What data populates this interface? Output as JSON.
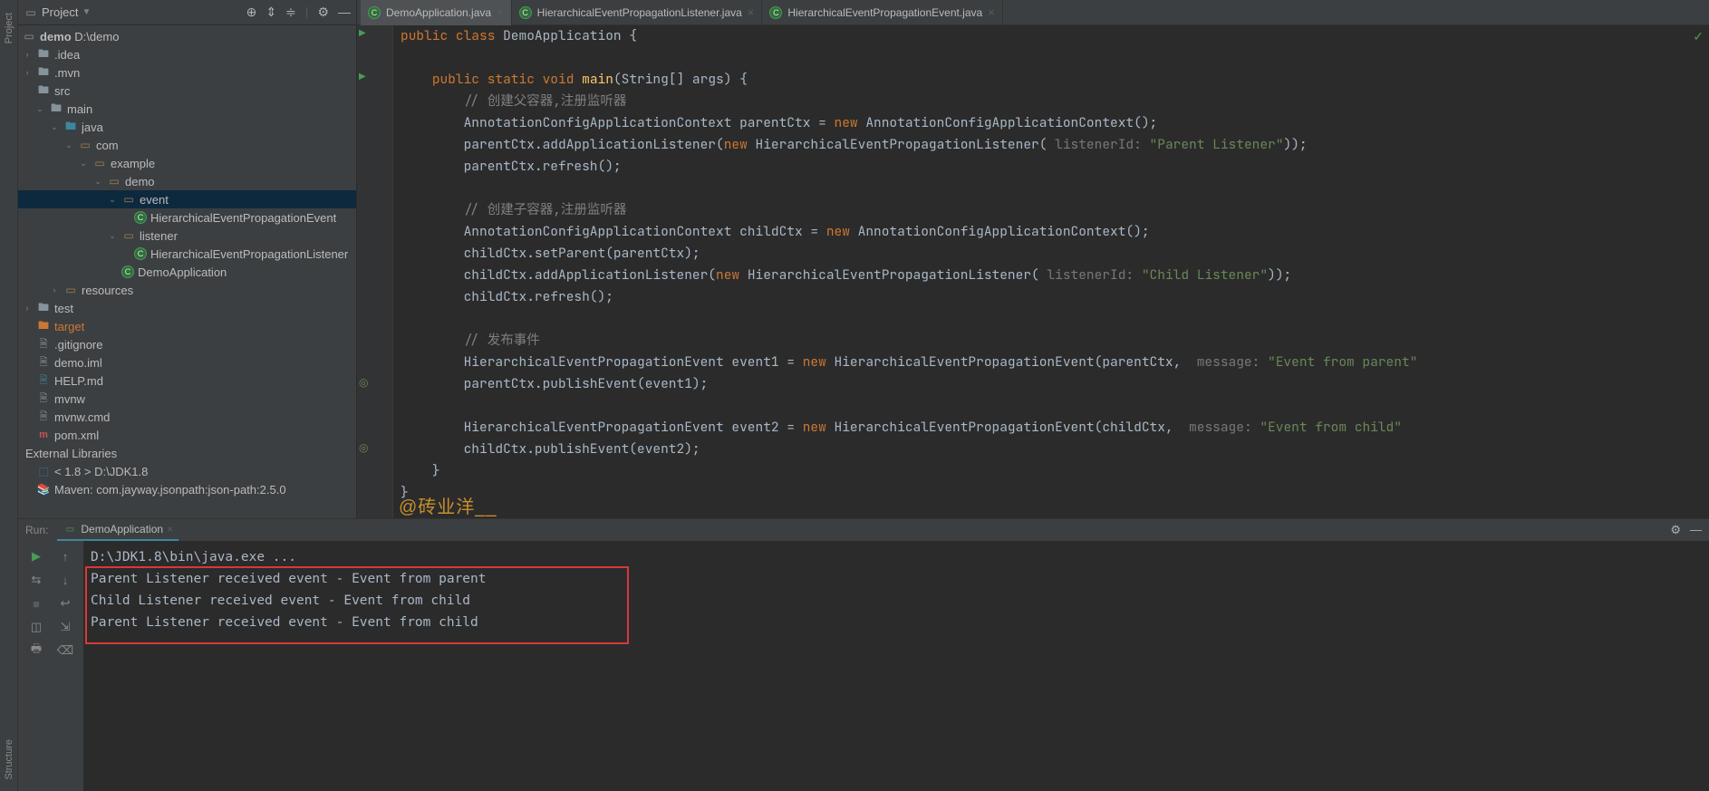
{
  "sidebar": {
    "title": "Project",
    "root_name": "demo",
    "root_path": "D:\\demo",
    "nodes": {
      "idea": ".idea",
      "mvn": ".mvn",
      "src": "src",
      "main": "main",
      "java": "java",
      "com": "com",
      "example": "example",
      "demo": "demo",
      "event": "event",
      "hev": "HierarchicalEventPropagationEvent",
      "listener": "listener",
      "hlis": "HierarchicalEventPropagationListener",
      "demoapp": "DemoApplication",
      "resources": "resources",
      "test": "test",
      "target": "target",
      "gitignore": ".gitignore",
      "demoiml": "demo.iml",
      "help": "HELP.md",
      "mvnw": "mvnw",
      "mvnwcmd": "mvnw.cmd",
      "pom": "pom.xml",
      "extlib": "External Libraries",
      "jdk_left": "< 1.8 >",
      "jdk_path": "D:\\JDK1.8",
      "maven": "Maven: com.jayway.jsonpath:json-path:2.5.0"
    }
  },
  "tabs": {
    "t1": "DemoApplication.java",
    "t2": "HierarchicalEventPropagationListener.java",
    "t3": "HierarchicalEventPropagationEvent.java"
  },
  "code": {
    "l1a": "public class ",
    "l1b": "DemoApplication",
    "l1c": " {",
    "l3a": "public static void ",
    "l3b": "main",
    "l3c": "(String[] args) {",
    "l4": "// 创建父容器,注册监听器",
    "l5a": "AnnotationConfigApplicationContext parentCtx = ",
    "l5b": "new ",
    "l5c": "AnnotationConfigApplicationContext();",
    "l6a": "parentCtx.addApplicationListener(",
    "l6b": "new ",
    "l6c": "HierarchicalEventPropagationListener(",
    "l6h": " listenerId: ",
    "l6d": "\"Parent Listener\"",
    "l6e": "));",
    "l7": "parentCtx.refresh();",
    "l9": "// 创建子容器,注册监听器",
    "l10a": "AnnotationConfigApplicationContext childCtx = ",
    "l10b": "new ",
    "l10c": "AnnotationConfigApplicationContext();",
    "l11": "childCtx.setParent(parentCtx);",
    "l12a": "childCtx.addApplicationListener(",
    "l12b": "new ",
    "l12c": "HierarchicalEventPropagationListener(",
    "l12h": " listenerId: ",
    "l12d": "\"Child Listener\"",
    "l12e": "));",
    "l13": "childCtx.refresh();",
    "l15": "// 发布事件",
    "l16a": "HierarchicalEventPropagationEvent event1 = ",
    "l16b": "new ",
    "l16c": "HierarchicalEventPropagationEvent(parentCtx, ",
    "l16h": " message: ",
    "l16d": "\"Event from parent\"",
    "l17": "parentCtx.publishEvent(event1);",
    "l19a": "HierarchicalEventPropagationEvent event2 = ",
    "l19b": "new ",
    "l19c": "HierarchicalEventPropagationEvent(childCtx, ",
    "l19h": " message: ",
    "l19d": "\"Event from child\"",
    "l20": "childCtx.publishEvent(event2);",
    "l21": "}",
    "l22": "}"
  },
  "watermark": "@砖业洋__",
  "run": {
    "label": "Run:",
    "tab": "DemoApplication",
    "line1": "D:\\JDK1.8\\bin\\java.exe ...",
    "out1": "Parent Listener received event - Event from parent",
    "out2": "Child Listener received event - Event from child",
    "out3": "Parent Listener received event - Event from child"
  }
}
